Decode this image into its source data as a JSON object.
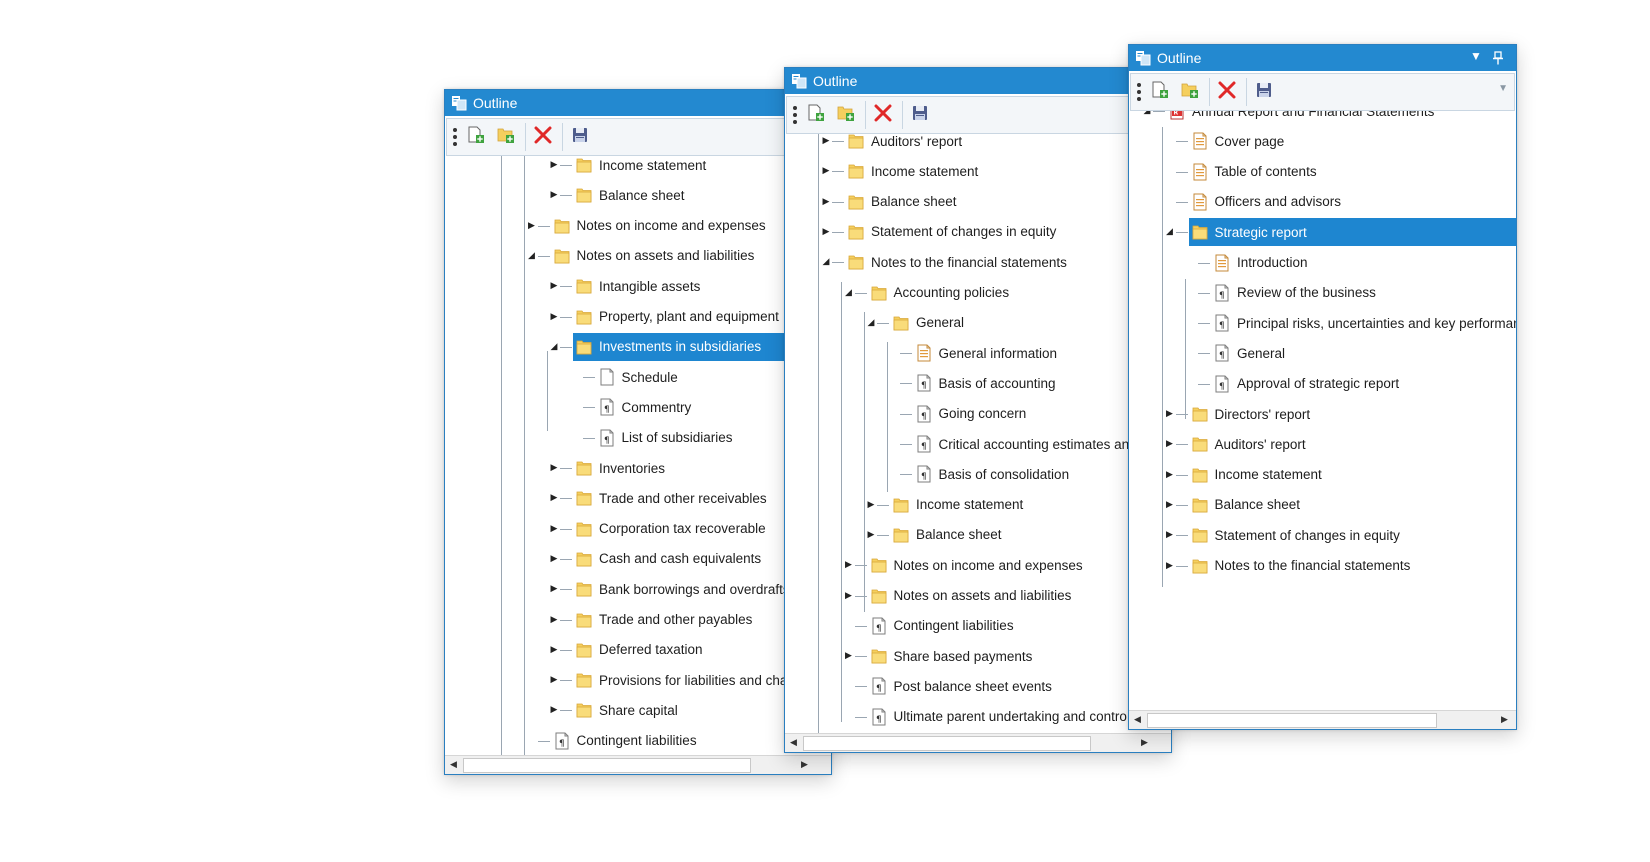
{
  "title": "Outline",
  "toolbar": {
    "items": [
      "grip-icon",
      "new-document-icon",
      "new-folder-icon",
      "delete-icon",
      "save-icon"
    ]
  },
  "colors": {
    "titlebar": "#2389d0",
    "selection": "#1e86d0",
    "folder": "#f5cf5e"
  },
  "win1": {
    "title": "Outline",
    "rows": [
      {
        "label": "Income statement",
        "icon": "folder-icon",
        "expander": "collapsed",
        "selected": false
      },
      {
        "label": "Balance sheet",
        "icon": "folder-icon",
        "expander": "collapsed",
        "selected": false
      },
      {
        "label": "Notes on income and expenses",
        "icon": "folder-icon",
        "expander": "collapsed",
        "selected": false
      },
      {
        "label": "Notes on assets and liabilities",
        "icon": "folder-icon",
        "expander": "expanded",
        "selected": false
      },
      {
        "label": "Intangible assets",
        "icon": "folder-icon",
        "expander": "collapsed",
        "selected": false
      },
      {
        "label": "Property, plant and equipment",
        "icon": "folder-icon",
        "expander": "collapsed",
        "selected": false
      },
      {
        "label": "Investments in subsidiaries",
        "icon": "folder-icon",
        "expander": "expanded",
        "selected": true
      },
      {
        "label": "Schedule",
        "icon": "blank-page-icon",
        "expander": "none",
        "selected": false
      },
      {
        "label": "Commentry",
        "icon": "paragraph-page-icon",
        "expander": "none",
        "selected": false
      },
      {
        "label": "List of subsidiaries",
        "icon": "paragraph-page-icon",
        "expander": "none",
        "selected": false
      },
      {
        "label": "Inventories",
        "icon": "folder-icon",
        "expander": "collapsed",
        "selected": false
      },
      {
        "label": "Trade and other receivables",
        "icon": "folder-icon",
        "expander": "collapsed",
        "selected": false
      },
      {
        "label": "Corporation tax recoverable",
        "icon": "folder-icon",
        "expander": "collapsed",
        "selected": false
      },
      {
        "label": "Cash and cash equivalents",
        "icon": "folder-icon",
        "expander": "collapsed",
        "selected": false
      },
      {
        "label": "Bank borrowings and overdrafts",
        "icon": "folder-icon",
        "expander": "collapsed",
        "selected": false
      },
      {
        "label": "Trade and other payables",
        "icon": "folder-icon",
        "expander": "collapsed",
        "selected": false
      },
      {
        "label": "Deferred taxation",
        "icon": "folder-icon",
        "expander": "collapsed",
        "selected": false
      },
      {
        "label": "Provisions for liabilities and charges",
        "icon": "folder-icon",
        "expander": "collapsed",
        "selected": false
      },
      {
        "label": "Share capital",
        "icon": "folder-icon",
        "expander": "collapsed",
        "selected": false
      },
      {
        "label": "Contingent liabilities",
        "icon": "paragraph-page-icon",
        "expander": "none",
        "selected": false
      }
    ]
  },
  "win2": {
    "title": "Outline",
    "rows": [
      {
        "label": "Auditors' report",
        "icon": "folder-icon",
        "expander": "collapsed",
        "selected": false
      },
      {
        "label": "Income statement",
        "icon": "folder-icon",
        "expander": "collapsed",
        "selected": false
      },
      {
        "label": "Balance sheet",
        "icon": "folder-icon",
        "expander": "collapsed",
        "selected": false
      },
      {
        "label": "Statement of changes in equity",
        "icon": "folder-icon",
        "expander": "collapsed",
        "selected": false
      },
      {
        "label": "Notes to the financial statements",
        "icon": "folder-icon",
        "expander": "expanded",
        "selected": false
      },
      {
        "label": "Accounting policies",
        "icon": "folder-icon",
        "expander": "expanded",
        "selected": false
      },
      {
        "label": "General",
        "icon": "folder-icon",
        "expander": "expanded",
        "selected": false
      },
      {
        "label": "General information",
        "icon": "lined-page-icon",
        "expander": "none",
        "selected": false
      },
      {
        "label": "Basis of accounting",
        "icon": "paragraph-page-icon",
        "expander": "none",
        "selected": false
      },
      {
        "label": "Going concern",
        "icon": "paragraph-page-icon",
        "expander": "none",
        "selected": false
      },
      {
        "label": "Critical accounting estimates and",
        "icon": "paragraph-page-icon",
        "expander": "none",
        "selected": false
      },
      {
        "label": "Basis of consolidation",
        "icon": "paragraph-page-icon",
        "expander": "none",
        "selected": false
      },
      {
        "label": "Income statement",
        "icon": "folder-icon",
        "expander": "collapsed",
        "selected": false
      },
      {
        "label": "Balance sheet",
        "icon": "folder-icon",
        "expander": "collapsed",
        "selected": false
      },
      {
        "label": "Notes on income and expenses",
        "icon": "folder-icon",
        "expander": "collapsed",
        "selected": false
      },
      {
        "label": "Notes on assets and liabilities",
        "icon": "folder-icon",
        "expander": "collapsed",
        "selected": false
      },
      {
        "label": "Contingent liabilities",
        "icon": "paragraph-page-icon",
        "expander": "none",
        "selected": false
      },
      {
        "label": "Share based payments",
        "icon": "folder-icon",
        "expander": "collapsed",
        "selected": false
      },
      {
        "label": "Post balance sheet events",
        "icon": "paragraph-page-icon",
        "expander": "none",
        "selected": false
      },
      {
        "label": "Ultimate parent undertaking and contro",
        "icon": "paragraph-page-icon",
        "expander": "none",
        "selected": false
      }
    ]
  },
  "win3": {
    "title": "Outline",
    "rows": [
      {
        "label": "Annual Report and Financial Statements",
        "icon": "report-icon",
        "expander": "expanded",
        "selected": false
      },
      {
        "label": "Cover page",
        "icon": "lined-page-icon",
        "expander": "none",
        "selected": false
      },
      {
        "label": "Table of contents",
        "icon": "lined-page-icon",
        "expander": "none",
        "selected": false
      },
      {
        "label": "Officers and advisors",
        "icon": "lined-page-icon",
        "expander": "none",
        "selected": false
      },
      {
        "label": "Strategic report",
        "icon": "folder-icon",
        "expander": "expanded",
        "selected": true
      },
      {
        "label": "Introduction",
        "icon": "lined-page-icon",
        "expander": "none",
        "selected": false
      },
      {
        "label": "Review of the business",
        "icon": "paragraph-page-icon",
        "expander": "none",
        "selected": false
      },
      {
        "label": "Principal risks, uncertainties and key performan",
        "icon": "paragraph-page-icon",
        "expander": "none",
        "selected": false
      },
      {
        "label": "General",
        "icon": "paragraph-page-icon",
        "expander": "none",
        "selected": false
      },
      {
        "label": "Approval of strategic report",
        "icon": "paragraph-page-icon",
        "expander": "none",
        "selected": false
      },
      {
        "label": "Directors' report",
        "icon": "folder-icon",
        "expander": "collapsed",
        "selected": false
      },
      {
        "label": "Auditors' report",
        "icon": "folder-icon",
        "expander": "collapsed",
        "selected": false
      },
      {
        "label": "Income statement",
        "icon": "folder-icon",
        "expander": "collapsed",
        "selected": false
      },
      {
        "label": "Balance sheet",
        "icon": "folder-icon",
        "expander": "collapsed",
        "selected": false
      },
      {
        "label": "Statement of changes in equity",
        "icon": "folder-icon",
        "expander": "collapsed",
        "selected": false
      },
      {
        "label": "Notes to the financial statements",
        "icon": "folder-icon",
        "expander": "collapsed",
        "selected": false
      }
    ]
  }
}
